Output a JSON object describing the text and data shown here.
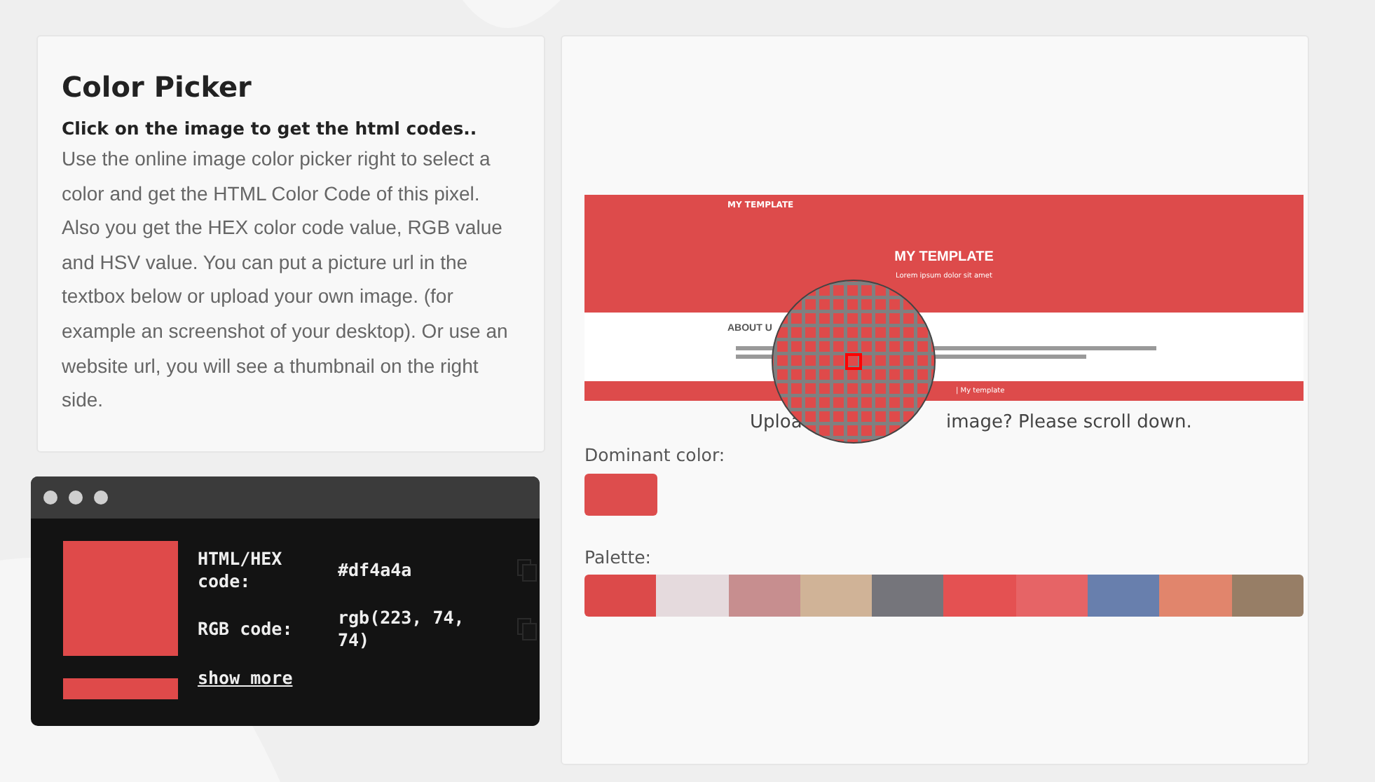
{
  "intro": {
    "title": "Color Picker",
    "subtitle": "Click on the image to get the html codes..",
    "body": "Use the online image color picker right to select a color and get the HTML Color Code of this pixel. Also you get the HEX color code value, RGB value and HSV value. You can put a picture url in the textbox below or upload your own image. (for example an screenshot of your desktop). Or use an website url, you will see a thumbnail on the right side."
  },
  "result": {
    "color": "#df4a4a",
    "rows": [
      {
        "label": "HTML/HEX code:",
        "value": "#df4a4a"
      },
      {
        "label": "RGB code:",
        "value": "rgb(223, 74, 74)"
      }
    ],
    "show_more": "show more"
  },
  "preview": {
    "nav": "MY TEMPLATE",
    "title": "MY TEMPLATE",
    "tagline": "Lorem ipsum dolor sit amet",
    "section": "ABOUT U",
    "footer": "| My template"
  },
  "upload_note": [
    "Uploa",
    "image? Please scroll down."
  ],
  "dominant": {
    "label": "Dominant color:",
    "color": "#dd4d4d"
  },
  "palette": {
    "label": "Palette:",
    "colors": [
      {
        "color": "#dc4a4a"
      },
      {
        "color": "#e5dadd"
      },
      {
        "color": "#c78e8f"
      },
      {
        "color": "#d0b397"
      },
      {
        "color": "#75757b"
      },
      {
        "color": "#e45152"
      },
      {
        "color": "#e66466"
      },
      {
        "color": "#687fad"
      },
      {
        "color": "#e1856c"
      },
      {
        "color": "#977e66"
      }
    ]
  }
}
